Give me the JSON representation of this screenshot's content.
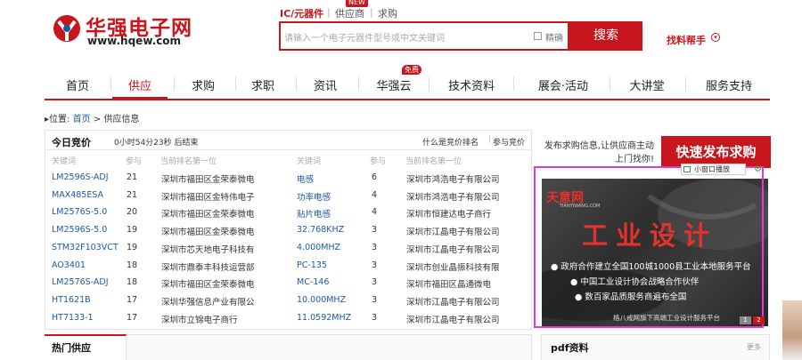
{
  "brand": {
    "name_cn": "华强电子网",
    "url": "www.hqew.com",
    "color": "#c8161d"
  },
  "search": {
    "tabs": [
      "IC/元器件",
      "供应商",
      "求购"
    ],
    "active_tab": "IC/元器件",
    "new_badge": "NEW",
    "placeholder": "请输入一个电子元器件型号或中文关键词",
    "exact_label": "精确",
    "button": "搜索",
    "helper": "找料帮手",
    "helper_icon": "down-circle-icon"
  },
  "nav": {
    "items": [
      "首页",
      "供应",
      "求购",
      "求职",
      "资讯",
      "华强云",
      "技术资料",
      "展会·活动",
      "大讲堂",
      "服务支持"
    ],
    "active": "供应",
    "hot_badge": "免费"
  },
  "breadcrumb": {
    "prefix": "位置:",
    "home": "首页",
    "separator": ">",
    "current": "供应信息"
  },
  "bidding": {
    "title": "今日竞价",
    "timer_hours": "0",
    "timer_minutes": "54",
    "timer_seconds": "23",
    "timer_text": "0小时54分23秒 后结束",
    "what_link": "什么是竞价排名",
    "rule_link": "参与竞价",
    "headers": [
      "关键词",
      "参与",
      "当前排名第一位"
    ],
    "left_rows": [
      {
        "kw": "LM2596S-ADJ",
        "count": "21",
        "company": "深圳市福田区金荣泰微电"
      },
      {
        "kw": "MAX485ESA",
        "count": "21",
        "company": "深圳市福田区金特伟电子"
      },
      {
        "kw": "LM2576S-5.0",
        "count": "20",
        "company": "深圳市福田区金荣泰微电"
      },
      {
        "kw": "LM2596S-5.0",
        "count": "19",
        "company": "深圳市福田区金荣泰微电"
      },
      {
        "kw": "STM32F103VCT",
        "count": "19",
        "company": "深圳市芯天地电子科技有"
      },
      {
        "kw": "AO3401",
        "count": "18",
        "company": "深圳市鼎泰丰科技运营部"
      },
      {
        "kw": "LM2576S-ADJ",
        "count": "18",
        "company": "深圳市福田区金荣泰微电"
      },
      {
        "kw": "HT1621B",
        "count": "17",
        "company": "深圳华强信息产业有限公"
      },
      {
        "kw": "HT7133-1",
        "count": "17",
        "company": "深圳市立锦电子商行"
      }
    ],
    "right_rows": [
      {
        "kw": "电感",
        "count": "6",
        "company": "深圳市鸿浩电子有限公司"
      },
      {
        "kw": "功率电感",
        "count": "4",
        "company": "深圳市鸿浩电子有限公司"
      },
      {
        "kw": "贴片电感",
        "count": "4",
        "company": "深圳市恒建达电子商行"
      },
      {
        "kw": "32.768KHZ",
        "count": "3",
        "company": "深圳市江晶电子有限公司"
      },
      {
        "kw": "4.000MHZ",
        "count": "3",
        "company": "深圳市江晶电子有限公司"
      },
      {
        "kw": "PC-135",
        "count": "3",
        "company": "深圳市创业晶振科技有限"
      },
      {
        "kw": "MC-146",
        "count": "3",
        "company": "深圳市福田区晶通微电"
      },
      {
        "kw": "10.000MHZ",
        "count": "3",
        "company": "深圳市江晶电子有限公司"
      },
      {
        "kw": "11.0592MHZ",
        "count": "3",
        "company": "深圳市江晶电子有限公司"
      }
    ]
  },
  "publish": {
    "text": "发布求购信息,让供应商主动上门找你!",
    "button": "快速发布求购"
  },
  "ad": {
    "small_window": "小窗口播放",
    "logo": "天意网",
    "logo_sub": "TIANYIWANG.COM",
    "title": "工业设计",
    "lines": [
      "政府合作建立全国100城1000县工业本地服务平台",
      "中国工业设计协会战略合作伙伴",
      "数百家品质服务商遍布全国"
    ],
    "footer": "格八戒网旗下高端工业设计服务平台",
    "pages": [
      "1",
      "2"
    ]
  },
  "sections": {
    "hot_supply": "热门供应",
    "pdf": "pdf资料",
    "pdf_more": "更多"
  }
}
